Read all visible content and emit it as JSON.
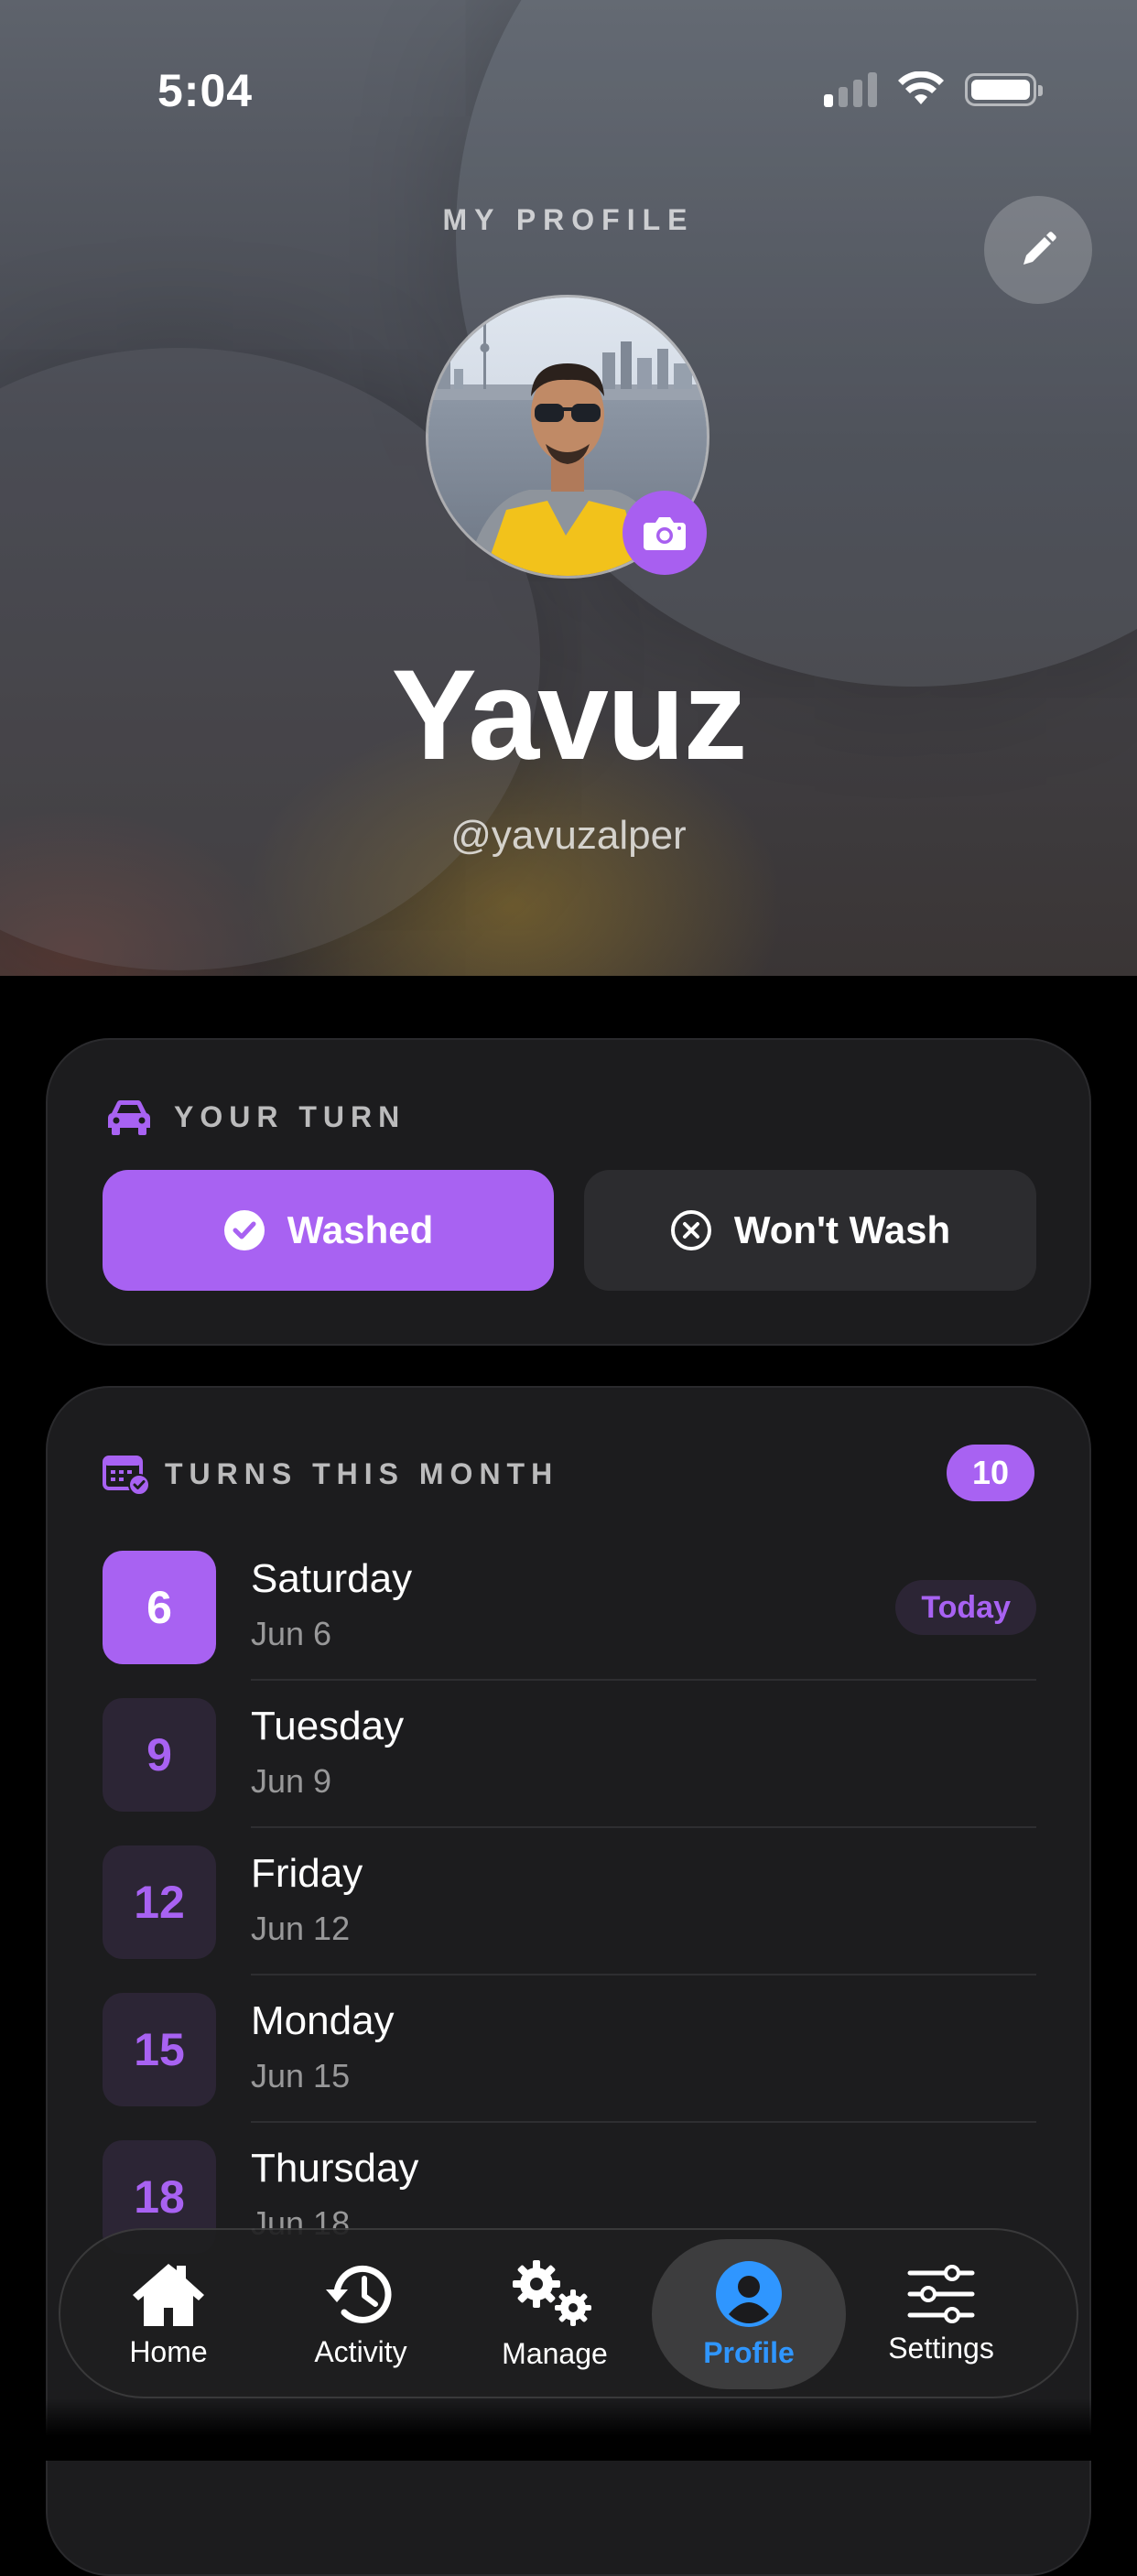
{
  "status_bar": {
    "time": "5:04"
  },
  "header": {
    "title": "MY PROFILE",
    "name": "Yavuz",
    "handle": "@yavuzalper"
  },
  "your_turn": {
    "label": "YOUR TURN",
    "washed_label": "Washed",
    "wont_wash_label": "Won't Wash"
  },
  "turns_this_month": {
    "label": "TURNS THIS MONTH",
    "count": "10",
    "today_label": "Today",
    "rows": [
      {
        "day": "6",
        "weekday": "Saturday",
        "date": "Jun 6",
        "today": true
      },
      {
        "day": "9",
        "weekday": "Tuesday",
        "date": "Jun 9"
      },
      {
        "day": "12",
        "weekday": "Friday",
        "date": "Jun 12"
      },
      {
        "day": "15",
        "weekday": "Monday",
        "date": "Jun 15"
      },
      {
        "day": "18",
        "weekday": "Thursday",
        "date": "Jun 18"
      }
    ]
  },
  "tabbar": {
    "items": [
      {
        "label": "Home",
        "icon": "home-icon"
      },
      {
        "label": "Activity",
        "icon": "history-icon"
      },
      {
        "label": "Manage",
        "icon": "gears-icon"
      },
      {
        "label": "Profile",
        "icon": "person-icon",
        "active": true
      },
      {
        "label": "Settings",
        "icon": "sliders-icon"
      }
    ]
  },
  "colors": {
    "accent": "#a862f2",
    "active_tab": "#2f96ff",
    "card_bg": "#1c1c1e"
  }
}
